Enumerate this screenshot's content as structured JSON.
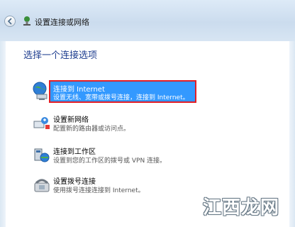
{
  "window": {
    "title": "设置连接或网络"
  },
  "heading": "选择一个连接选项",
  "options": [
    {
      "label": "连接到 Internet",
      "desc": "设置无线、宽带或拨号连接，连接到 Internet。",
      "icon": "globe-network-icon",
      "selected": true
    },
    {
      "label": "设置新网络",
      "desc": "配置新的路由器或访问点。",
      "icon": "router-setup-icon",
      "selected": false
    },
    {
      "label": "连接到工作区",
      "desc": "设置到您的工作区的拨号或 VPN 连接。",
      "icon": "workplace-network-icon",
      "selected": false
    },
    {
      "label": "设置拨号连接",
      "desc": "使用拨号连接连接到 Internet。",
      "icon": "dialup-phone-icon",
      "selected": false
    }
  ],
  "watermark": "江西龙网",
  "colors": {
    "selection": "#3399ff",
    "highlight_border": "#e21e26",
    "heading": "#1e3d8f"
  }
}
